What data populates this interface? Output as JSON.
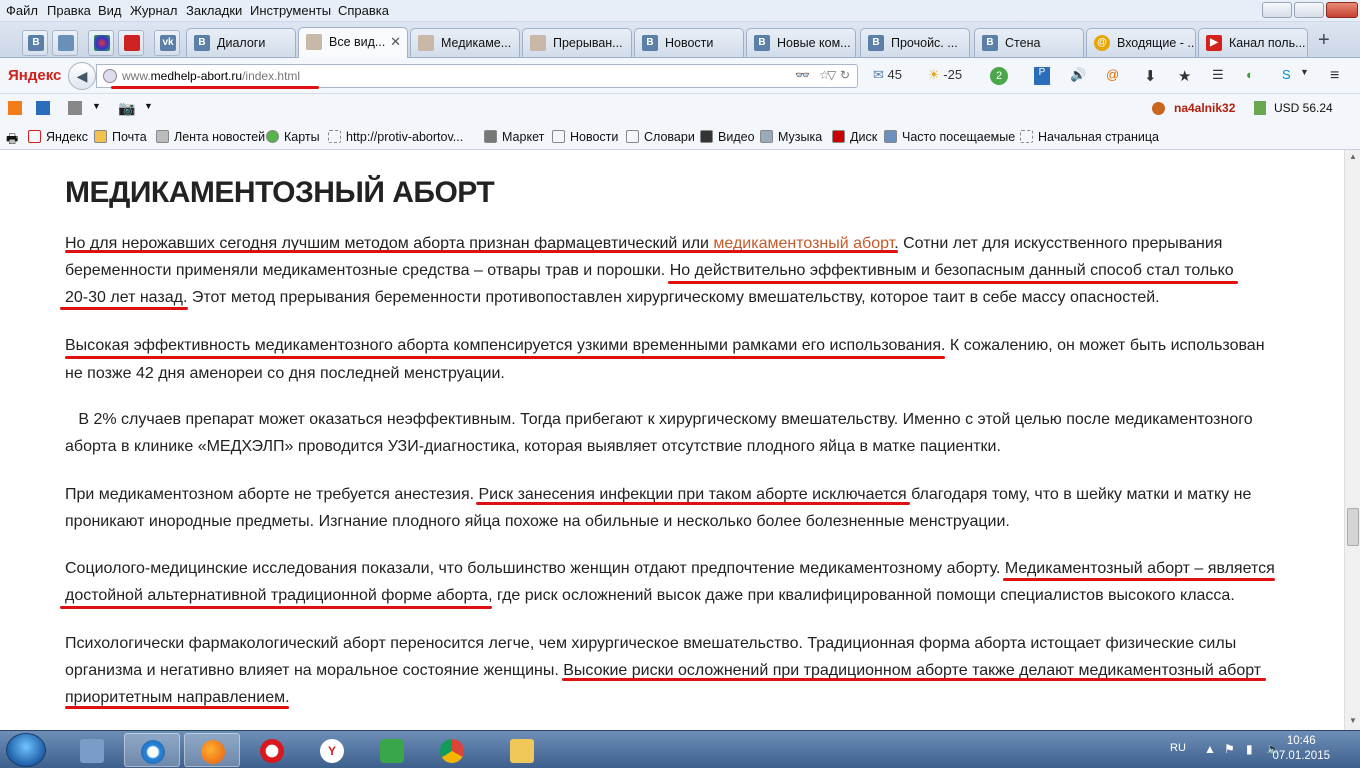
{
  "menu": [
    "Файл",
    "Правка",
    "Вид",
    "Журнал",
    "Закладки",
    "Инструменты",
    "Справка"
  ],
  "tabs": [
    {
      "label": "Диалоги",
      "icon": "vk-icon",
      "active": false
    },
    {
      "label": "Все вид...",
      "icon": "woman-icon",
      "active": true
    },
    {
      "label": "Медикаме...",
      "icon": "woman-icon",
      "active": false
    },
    {
      "label": "Прерыван...",
      "icon": "woman-icon",
      "active": false
    },
    {
      "label": "Новости",
      "icon": "vk-icon",
      "active": false
    },
    {
      "label": "Новые ком...",
      "icon": "vk-icon",
      "active": false
    },
    {
      "label": "Прочойс. ...",
      "icon": "vk-icon",
      "active": false
    },
    {
      "label": "Стена",
      "icon": "vk-icon",
      "active": false
    },
    {
      "label": "Входящие - ...",
      "icon": "mail-icon",
      "active": false
    },
    {
      "label": "Канал поль...",
      "icon": "youtube-icon",
      "active": false
    }
  ],
  "navbar": {
    "logo": "Яндекс",
    "url_prefix": "www.",
    "url_domain": "medhelp-abort.ru",
    "url_path": "/index.html",
    "mail_count": "45",
    "weather": "-25",
    "badge": "2"
  },
  "addonbar": {
    "user": "na4alnik32",
    "currency": "USD 56.24"
  },
  "bookmarks": [
    "Яндекс",
    "Почта",
    "Лента новостей",
    "Карты",
    "http://protiv-abortov...",
    "Маркет",
    "Новости",
    "Словари",
    "Видео",
    "Музыка",
    "Диск",
    "Часто посещаемые",
    "Начальная страница"
  ],
  "article": {
    "title": "МЕДИКАМЕНТОЗНЫЙ АБОРТ",
    "p1_l1_a": "Но для нерожавших сегодня лучшим методом аборта признан фармацевтический или ",
    "p1_l1_link": "медикаментозный аборт",
    "p1_l1_b": ". Сотни лет для искусственного прерывания",
    "p1_l2": "беременности применяли медикаментозные средства – отвары трав и порошки. Но действительно эффективным и безопасным данный способ стал только",
    "p1_l3": "20-30 лет назад. Этот метод прерывания беременности противопоставлен хирургическому вмешательству, которое таит в себе массу опасностей.",
    "p2_l1": "Высокая эффективность медикаментозного аборта компенсируется узкими временными рамками его использования. К сожалению, он может быть использован",
    "p2_l2": "не позже 42 дня аменореи со дня последней менструации.",
    "p3_l1": "   В 2% случаев препарат может оказаться неэффективным. Тогда прибегают к хирургическому вмешательству. Именно с этой целью после медикаментозного",
    "p3_l2": "аборта в клинике «МЕДХЭЛП» проводится УЗИ-диагностика, которая выявляет отсутствие плодного яйца в матке пациентки.",
    "p4_l1": "При медикаментозном аборте не требуется анестезия. Риск занесения инфекции при таком аборте исключается благодаря тому, что в шейку матки и матку не",
    "p4_l2": "проникают инородные предметы. Изгнание плодного яйца похоже на обильные и несколько более болезненные менструации.",
    "p5_l1": "Социолого-медицинские исследования показали, что большинство женщин отдают предпочтение медикаментозному аборту. Медикаментозный аборт – является",
    "p5_l2": "достойной альтернативной традиционной форме аборта, где риск осложнений высок даже при квалифицированной помощи специалистов высокого класса.",
    "p6_l1": "Психологически фармакологический аборт переносится легче, чем хирургическое вмешательство. Традиционная форма аборта истощает физические силы",
    "p6_l2": "организма и негативно влияет на моральное состояние женщины. Высокие риски осложнений при традиционном аборте также делают медикаментозный аборт",
    "p6_l3": "приоритетным направлением."
  },
  "taskbar": {
    "lang": "RU",
    "time": "10:46",
    "date": "07.01.2015"
  },
  "colors": {
    "underline": "#e01010",
    "link": "#c55a2a",
    "taskbar": "#3d5f8c"
  }
}
